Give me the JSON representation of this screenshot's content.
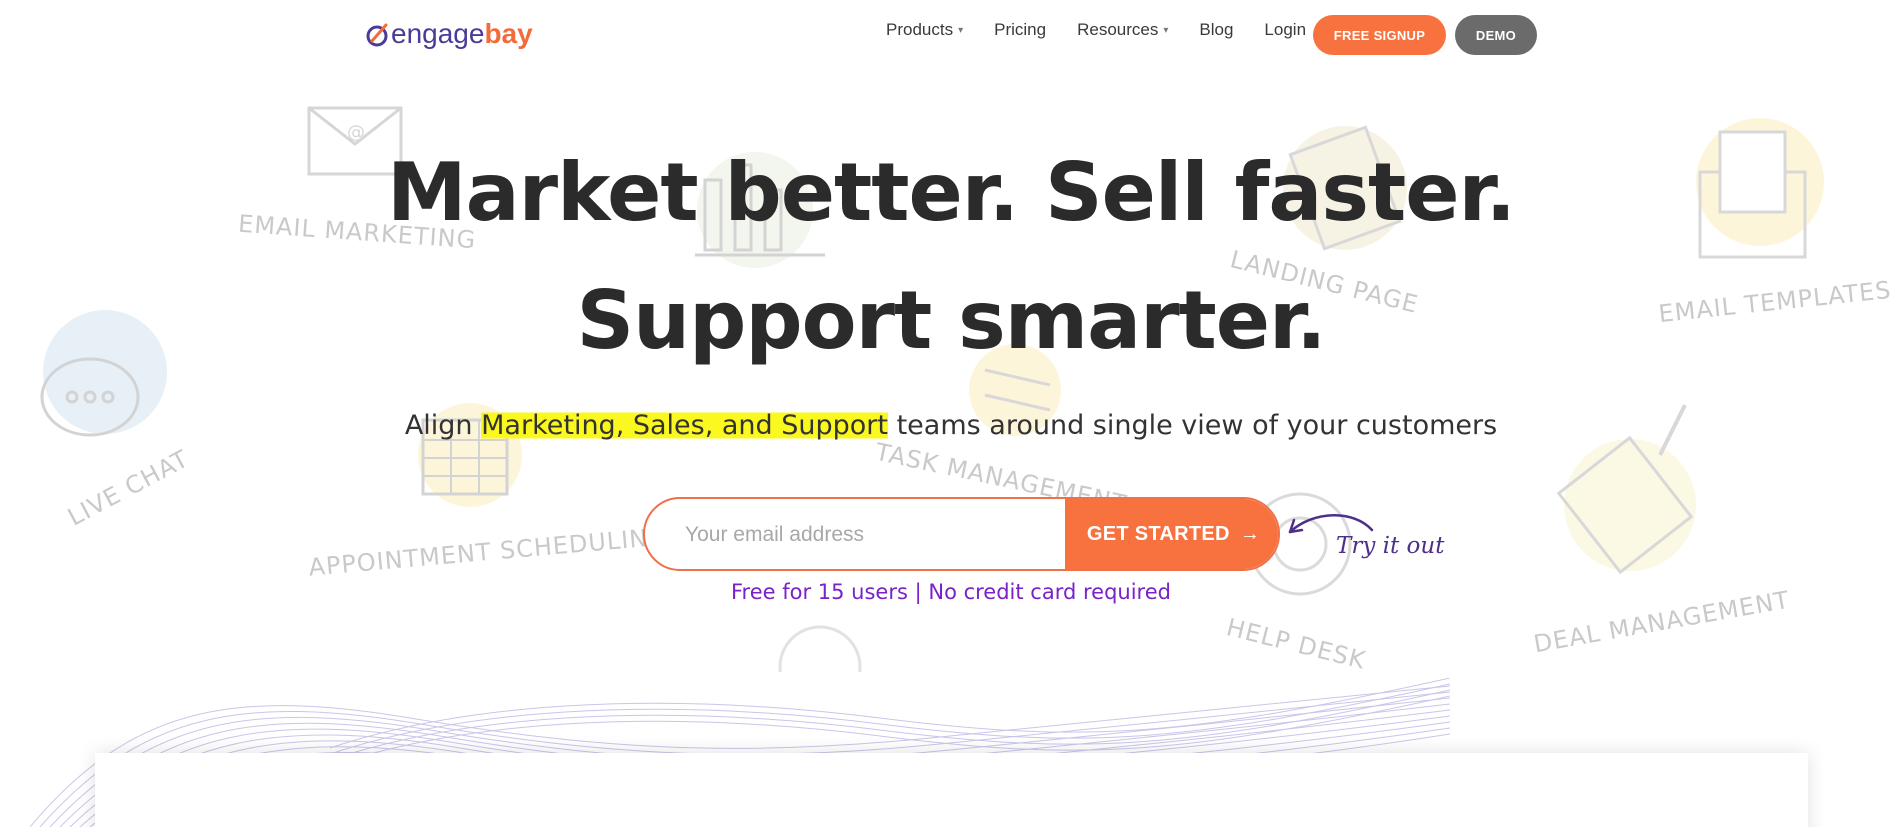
{
  "brand": {
    "name_a": "engage",
    "name_b": "bay"
  },
  "nav": {
    "items": [
      {
        "label": "Products",
        "has_dropdown": true
      },
      {
        "label": "Pricing",
        "has_dropdown": false
      },
      {
        "label": "Resources",
        "has_dropdown": true
      },
      {
        "label": "Blog",
        "has_dropdown": false
      },
      {
        "label": "Login",
        "has_dropdown": false
      }
    ],
    "signup_label": "FREE SIGNUP",
    "demo_label": "DEMO"
  },
  "hero": {
    "headline_1": "Market better. Sell faster.",
    "headline_2": "Support smarter.",
    "sub_before": "Align ",
    "sub_highlight": "Marketing, Sales, and Support",
    "sub_after": " teams around single view of your customers",
    "email_placeholder": "Your email address",
    "cta_label": "GET STARTED",
    "cta_arrow": "→",
    "try_label": "Try it out",
    "note": "Free for 15 users | No credit card required"
  },
  "background_labels": {
    "email_marketing": "EMAIL MARKETING",
    "landing_page": "LANDING PAGE",
    "email_templates": "EMAIL TEMPLATES",
    "live_chat": "LIVE CHAT",
    "task_management": "TASK MANAGEMENT",
    "appointment_scheduling": "APPOINTMENT SCHEDULING",
    "help_desk": "HELP DESK",
    "deal_management": "DEAL MANAGEMENT"
  },
  "colors": {
    "accent": "#f8723f",
    "brand_purple": "#4c3b96",
    "note_purple": "#7a22c9",
    "highlight": "#fbf81f",
    "demo_gray": "#6b6b6b"
  }
}
